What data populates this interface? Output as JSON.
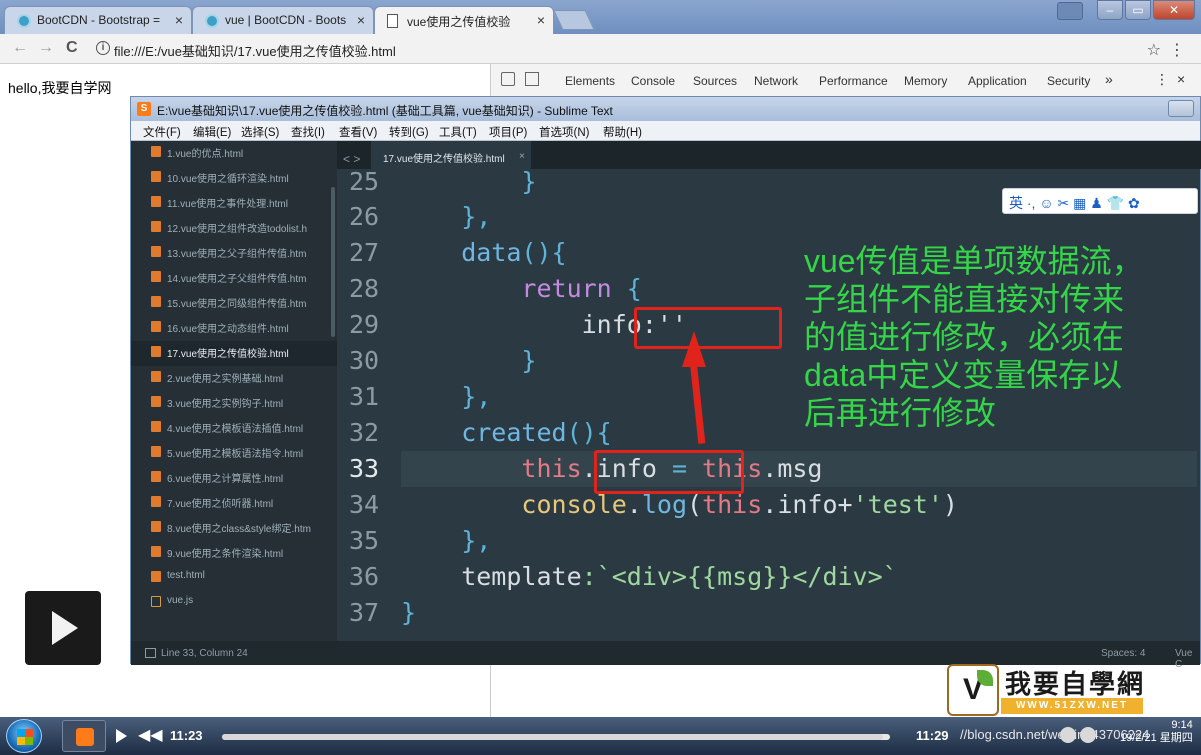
{
  "browser": {
    "tabs": [
      {
        "label": "BootCDN - Bootstrap ="
      },
      {
        "label": "vue | BootCDN - Boots"
      },
      {
        "label": "vue使用之传值校验"
      }
    ],
    "close_glyph": "×",
    "url": "file:///E:/vue基础知识/17.vue使用之传值校验.html",
    "info_glyph": "i",
    "back_glyph": "←",
    "forward_glyph": "→",
    "reload_glyph": "C",
    "star_glyph": "☆",
    "menu_glyph": "⋮"
  },
  "page": {
    "text": "hello,我要自学网"
  },
  "devtools": {
    "tabs": [
      "Elements",
      "Console",
      "Sources",
      "Network",
      "Performance",
      "Memory",
      "Application",
      "Security"
    ],
    "more_glyph": "»",
    "kebab_glyph": "⋮",
    "close_glyph": "×"
  },
  "sublime": {
    "title": "E:\\vue基础知识\\17.vue使用之传值校验.html (基础工具篇, vue基础知识) - Sublime Text",
    "logo_glyph": "S",
    "menu": [
      "文件(F)",
      "编辑(E)",
      "选择(S)",
      "查找(I)",
      "查看(V)",
      "转到(G)",
      "工具(T)",
      "项目(P)",
      "首选项(N)",
      "帮助(H)"
    ],
    "files": [
      {
        "name": "1.vue的优点.html"
      },
      {
        "name": "10.vue使用之循环渲染.html"
      },
      {
        "name": "11.vue使用之事件处理.html"
      },
      {
        "name": "12.vue使用之组件改造todolist.h"
      },
      {
        "name": "13.vue使用之父子组件传值.htm"
      },
      {
        "name": "14.vue使用之子父组件传值.htm"
      },
      {
        "name": "15.vue使用之同级组件传值.htm"
      },
      {
        "name": "16.vue使用之动态组件.html"
      },
      {
        "name": "17.vue使用之传值校验.html"
      },
      {
        "name": "2.vue使用之实例基础.html"
      },
      {
        "name": "3.vue使用之实例钩子.html"
      },
      {
        "name": "4.vue使用之模板语法插值.html"
      },
      {
        "name": "5.vue使用之模板语法指令.html"
      },
      {
        "name": "6.vue使用之计算属性.html"
      },
      {
        "name": "7.vue使用之侦听器.html"
      },
      {
        "name": "8.vue使用之class&style绑定.htm"
      },
      {
        "name": "9.vue使用之条件渲染.html"
      },
      {
        "name": "test.html"
      },
      {
        "name": "vue.js"
      }
    ],
    "tab_arrows": "< >",
    "open_tab": "17.vue使用之传值校验.html",
    "tab_close": "×",
    "line_numbers": [
      "25",
      "26",
      "27",
      "28",
      "29",
      "30",
      "31",
      "32",
      "33",
      "34",
      "35",
      "36",
      "37"
    ],
    "code": {
      "l25": "        }",
      "l26": "    },",
      "l27_fn": "    data",
      "l27_rest": "(){",
      "l28_kw": "        return",
      "l28_rest": " {",
      "l29": "            info:''",
      "l30": "        }",
      "l31": "    },",
      "l32_fn": "    created",
      "l32_rest": "(){",
      "l33_a": "        this",
      "l33_b": ".info",
      "l33_c": " = ",
      "l33_d": "this",
      "l33_e": ".msg",
      "l34_a": "        console",
      "l34_b": ".",
      "l34_c": "log",
      "l34_d": "(",
      "l34_e": "this",
      "l34_f": ".info+",
      "l34_g": "'test'",
      "l34_h": ")",
      "l35": "    },",
      "l36_a": "    template",
      "l36_b": ":`<div>{{msg}}</div>`",
      "l37": "}"
    },
    "annotation": "vue传值是单项数据流，子组件不能直接对传来的值进行修改，必须在data中定义变量保存以后再进行修改",
    "ime_toolbar": "英 ·, ☺ ✂ ▦ ♟ 👕 ✿",
    "status_position": "Line 33, Column 24",
    "status_spaces": "Spaces: 4",
    "status_syntax": "Vue C"
  },
  "watermark": {
    "mark_glyph": "V",
    "cn": "我要自學網",
    "url": "WWW.51ZXW.NET"
  },
  "player": {
    "rewind_glyph": "◀◀",
    "elapsed": "11:23",
    "total": "11:29",
    "progress": 0.99,
    "overlay_text": "//blog.csdn.net/weixin_43706224",
    "clock_time": "9:14",
    "clock_date": "19/2/21 星期四"
  },
  "colors": {
    "annotation": "#35d54a",
    "highlight": "#e0231b",
    "editor_bg": "#2b3a42"
  }
}
